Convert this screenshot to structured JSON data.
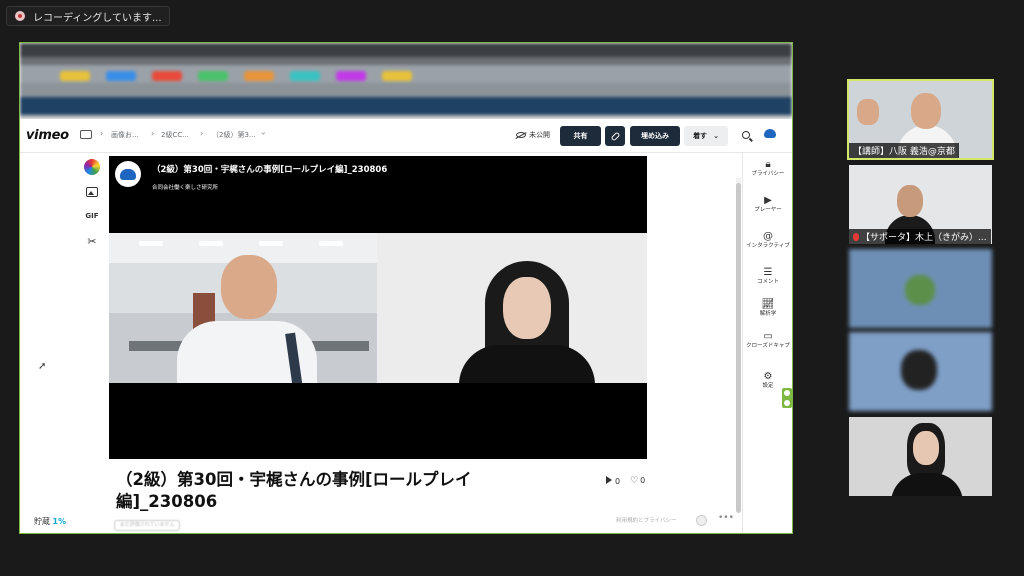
{
  "recording": {
    "label": "レコーディングしています..."
  },
  "vimeo": {
    "logo": "vimeo",
    "breadcrumb": [
      "画像お...",
      "2級CC...",
      "（2級）第3..."
    ],
    "privacy_label": "未公開",
    "share_label": "共有",
    "embed_label": "埋め込み",
    "dropdown_label": "着す",
    "side_menu": [
      "プライバシー",
      "プレーヤー",
      "インタラクティブ",
      "コメント",
      "解析学",
      "クローズドキャプ",
      "設定"
    ],
    "video": {
      "title": "（2級）第30回・宇梶さんの事例[ロールプレイ編]_230806",
      "company": "合同会社働く楽しさ研究所"
    },
    "page_title": "（2級）第30回・宇梶さんの事例[ロールプレイ編]_230806",
    "plays": "0",
    "likes": "0",
    "storage_label": "貯蔵",
    "storage_value": "1%",
    "tag_placeholder": "まだ評価されていません",
    "terms": "利用規約とプライバシー"
  },
  "participants": [
    {
      "name": "【講師】八阪 義浩@京都",
      "active": true
    },
    {
      "name": "【サポータ】木上（きがみ）...",
      "muted": true
    },
    {
      "name": ""
    },
    {
      "name": ""
    },
    {
      "name": ""
    }
  ],
  "colors": {
    "active_speaker": "#d3e866",
    "share_border": "#7db942",
    "vimeo_dark": "#1e2b3a",
    "storage_accent": "#11a7cf"
  }
}
